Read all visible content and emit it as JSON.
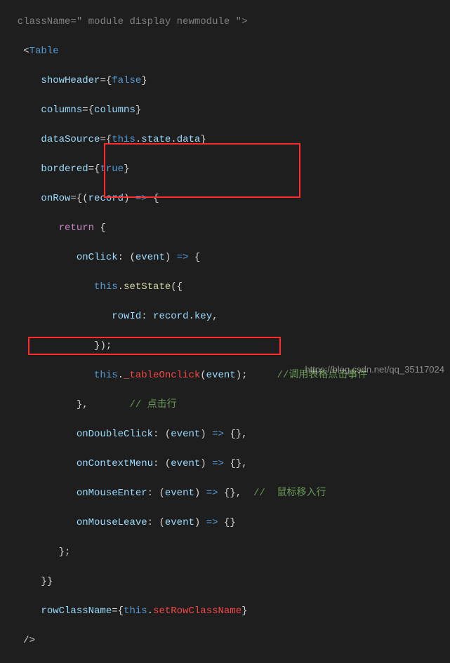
{
  "code": {
    "l00a": "  className",
    "l00b": " module display newmodule ",
    "l01": "Table",
    "l02_attr": "showHeader",
    "l02_val": "false",
    "l03_attr": "columns",
    "l03_val": "columns",
    "l04_attr": "dataSource",
    "l04_this": "this",
    "l04_state": "state",
    "l04_data": "data",
    "l05_attr": "bordered",
    "l05_val": "true",
    "l06_attr": "onRow",
    "l06_param": "record",
    "l07_return": "return",
    "l08_key": "onClick",
    "l08_param": "event",
    "l09_this": "this",
    "l09_method": "setState",
    "l10_key": "rowId",
    "l10_rec": "record",
    "l10_prop": "key",
    "l12_this": "this",
    "l12_method": "_tableOnclick",
    "l12_arg": "event",
    "l12_comment": "//调用表格点击事件",
    "l13_comment": "// 点击行",
    "l14_key": "onDoubleClick",
    "l14_param": "event",
    "l15_key": "onContextMenu",
    "l15_param": "event",
    "l16_key": "onMouseEnter",
    "l16_param": "event",
    "l16_comment": "//  鼠标移入行",
    "l17_key": "onMouseLeave",
    "l17_param": "event",
    "l20_attr": "rowClassName",
    "l20_this": "this",
    "l20_method": "setRowClassName"
  },
  "watermark": "https://blog.csdn.net/qq_35117024"
}
